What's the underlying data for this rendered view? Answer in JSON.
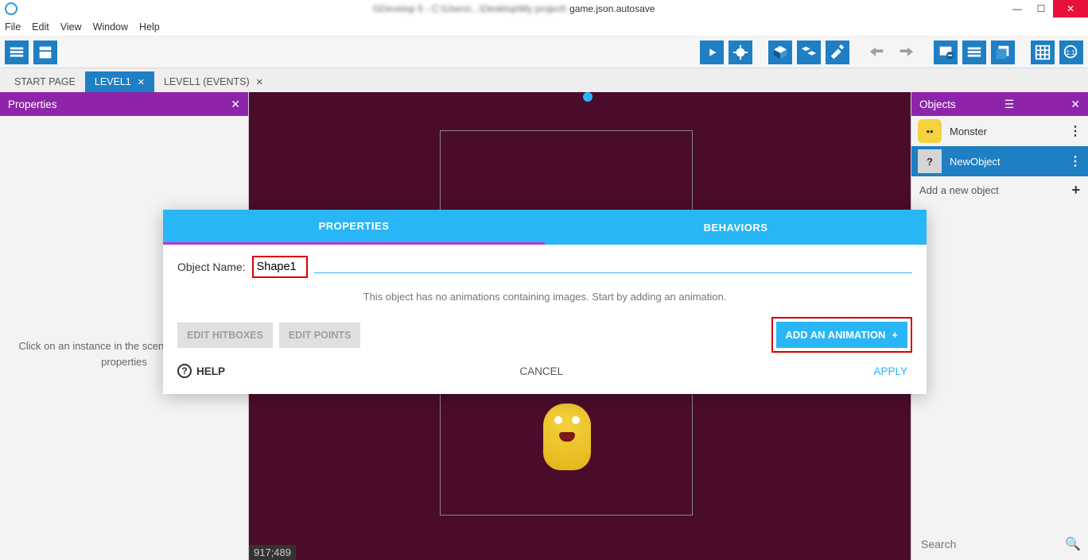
{
  "window": {
    "title_blur": "GDevelop 5 - C:\\Users\\...\\Desktop\\My project\\",
    "title_tail": "game.json.autosave"
  },
  "menu": {
    "items": [
      "File",
      "Edit",
      "View",
      "Window",
      "Help"
    ]
  },
  "tabs": {
    "items": [
      {
        "label": "START PAGE",
        "closable": false,
        "active": false
      },
      {
        "label": "LEVEL1",
        "closable": true,
        "active": true
      },
      {
        "label": "LEVEL1 (EVENTS)",
        "closable": true,
        "active": false
      }
    ]
  },
  "leftPanel": {
    "title": "Properties",
    "hint": "Click on an instance in the scene to display its properties"
  },
  "scene": {
    "coords": "917;489"
  },
  "rightPanel": {
    "title": "Objects",
    "items": [
      {
        "label": "Monster",
        "selected": false
      },
      {
        "label": "NewObject",
        "selected": true
      }
    ],
    "addLabel": "Add a new object",
    "searchPlaceholder": "Search"
  },
  "modal": {
    "tabs": {
      "properties": "PROPERTIES",
      "behaviors": "BEHAVIORS"
    },
    "objectNameLabel": "Object Name:",
    "objectNameValue": "Shape1",
    "noAnimHint": "This object has no animations containing images. Start by adding an animation.",
    "editHitboxes": "EDIT HITBOXES",
    "editPoints": "EDIT POINTS",
    "addAnimation": "ADD AN ANIMATION",
    "help": "HELP",
    "cancel": "CANCEL",
    "apply": "APPLY"
  }
}
